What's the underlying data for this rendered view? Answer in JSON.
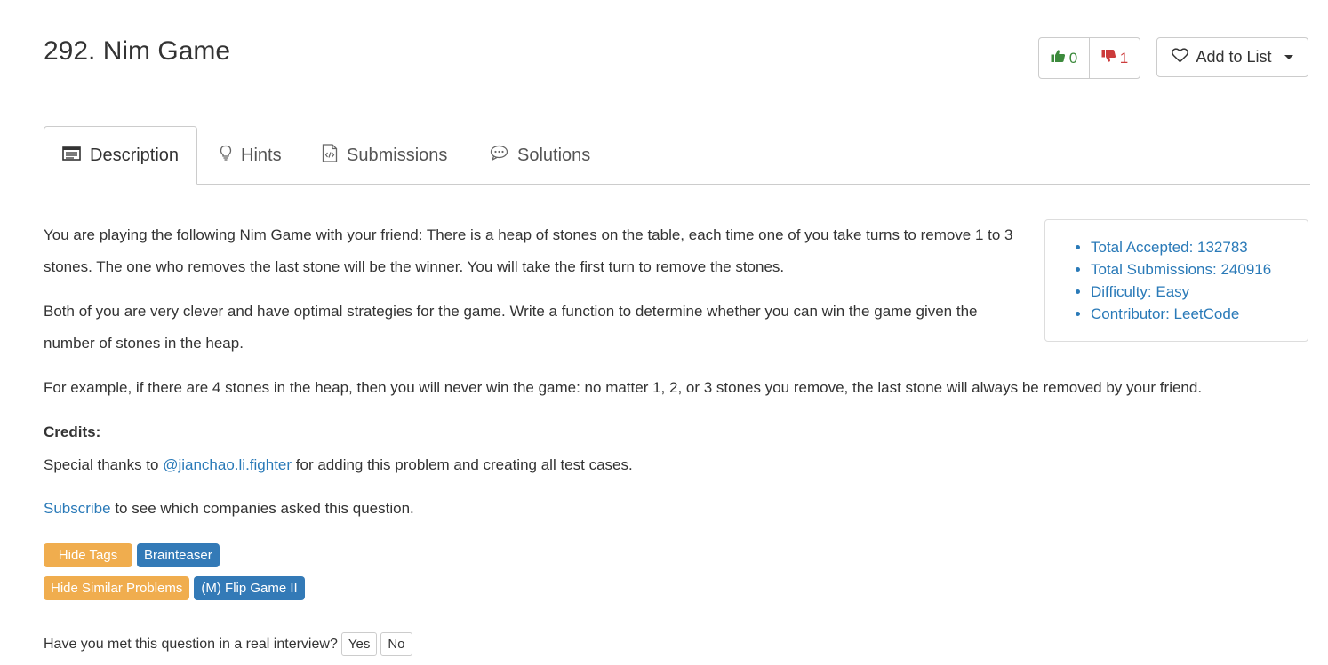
{
  "problem": {
    "title": "292. Nim Game"
  },
  "votes": {
    "up": "0",
    "down": "1"
  },
  "add_to_list": {
    "label": "Add to List"
  },
  "tabs": [
    {
      "label": "Description",
      "icon": "description-icon"
    },
    {
      "label": "Hints",
      "icon": "lightbulb-icon"
    },
    {
      "label": "Submissions",
      "icon": "code-file-icon"
    },
    {
      "label": "Solutions",
      "icon": "comment-icon"
    }
  ],
  "description": {
    "p1": "You are playing the following Nim Game with your friend: There is a heap of stones on the table, each time one of you take turns to remove 1 to 3 stones. The one who removes the last stone will be the winner. You will take the first turn to remove the stones.",
    "p2": "Both of you are very clever and have optimal strategies for the game. Write a function to determine whether you can win the game given the number of stones in the heap.",
    "p3": "For example, if there are 4 stones in the heap, then you will never win the game: no matter 1, 2, or 3 stones you remove, the last stone will always be removed by your friend.",
    "credits_heading": "Credits:",
    "credits_prefix": "Special thanks to ",
    "credits_link": "@jianchao.li.fighter",
    "credits_suffix": " for adding this problem and creating all test cases.",
    "subscribe_link": "Subscribe",
    "subscribe_suffix": " to see which companies asked this question."
  },
  "stats": {
    "total_accepted": "Total Accepted: 132783",
    "total_submissions": "Total Submissions: 240916",
    "difficulty": "Difficulty: Easy",
    "contributor": "Contributor: LeetCode"
  },
  "tags": {
    "hide_tags": "Hide Tags",
    "tag1": "Brainteaser",
    "hide_similar": "Hide Similar Problems",
    "similar1": "(M) Flip Game II"
  },
  "interview": {
    "question": "Have you met this question in a real interview?",
    "yes": "Yes",
    "no": "No"
  },
  "colors": {
    "link": "#2a7ab8",
    "tag_orange": "#f0ad4e",
    "tag_blue": "#337ab7",
    "thumb_up": "#3c8a3c",
    "thumb_down": "#cc3b3b"
  }
}
